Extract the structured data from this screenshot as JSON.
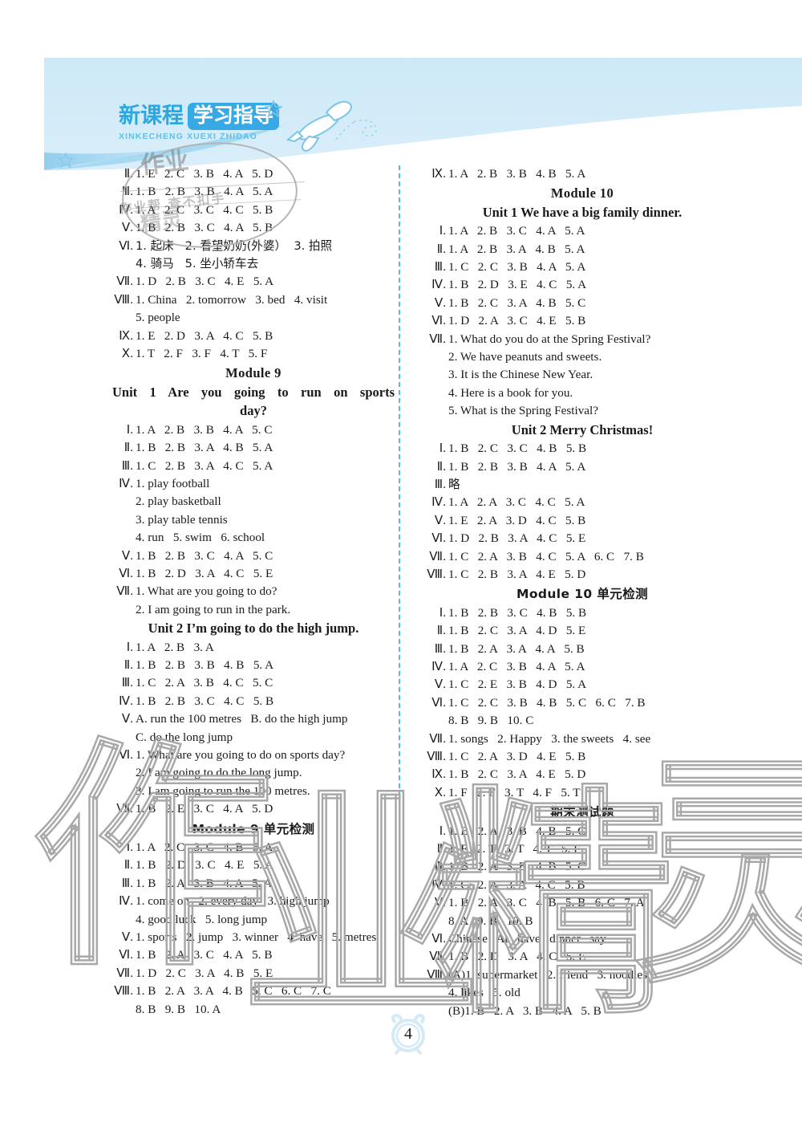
{
  "header": {
    "logo_cn_plain": "新课程",
    "logo_cn_chip": "学习指导",
    "logo_pinyin": "XINKECHENG XUEXI ZHIDAO",
    "plane_icon": "airplane-icon",
    "star_icon": "star-icon"
  },
  "watermark": {
    "chars": [
      "作",
      "业",
      "精",
      "灵"
    ],
    "stamp": "作业",
    "stamp_small": "作业帮 查不扣手",
    "stamp_sub": "精灵"
  },
  "footer": {
    "page_number": "4",
    "clock_icon": "alarm-clock-icon"
  },
  "left_column": {
    "blocks": [
      {
        "type": "answer",
        "rn": "Ⅱ.",
        "text": "1. E   2. C   3. B   4. A   5. D"
      },
      {
        "type": "answer",
        "rn": "Ⅲ.",
        "text": "1. B   2. B   3. B   4. A   5. A"
      },
      {
        "type": "answer",
        "rn": "Ⅳ.",
        "text": "1. A   2. C   3. C   4. C   5. B"
      },
      {
        "type": "answer",
        "rn": "Ⅴ.",
        "text": "1. B   2. B   3. C   4. A   5. B"
      },
      {
        "type": "answer",
        "rn": "Ⅵ.",
        "text": "1. 起床   2. 看望奶奶(外婆）  3. 拍照",
        "cn": true
      },
      {
        "type": "cont",
        "text": "4. 骑马   5. 坐小轿车去",
        "cn": true
      },
      {
        "type": "answer",
        "rn": "Ⅶ.",
        "text": "1. D   2. B   3. C   4. E   5. A"
      },
      {
        "type": "answer",
        "rn": "Ⅷ.",
        "text": "1. China   2. tomorrow   3. bed   4. visit"
      },
      {
        "type": "cont",
        "text": "5. people"
      },
      {
        "type": "answer",
        "rn": "Ⅸ.",
        "text": "1. E   2. D   3. A   4. C   5. B"
      },
      {
        "type": "answer",
        "rn": "Ⅹ.",
        "text": "1. T   2. F   3. F   4. T   5. F"
      },
      {
        "type": "module",
        "text": "Module 9"
      },
      {
        "type": "unit_justify",
        "text": "Unit 1   Are you going to run on sports"
      },
      {
        "type": "unit_center",
        "text": "day?"
      },
      {
        "type": "answer",
        "rn": "Ⅰ.",
        "text": "1. A   2. B   3. B   4. A   5. C"
      },
      {
        "type": "answer",
        "rn": "Ⅱ.",
        "text": "1. B   2. B   3. A   4. B   5. A"
      },
      {
        "type": "answer",
        "rn": "Ⅲ.",
        "text": "1. C   2. B   3. A   4. C   5. A"
      },
      {
        "type": "answer",
        "rn": "Ⅳ.",
        "text": "1. play football"
      },
      {
        "type": "cont",
        "text": "2. play basketball"
      },
      {
        "type": "cont",
        "text": "3. play table tennis"
      },
      {
        "type": "cont",
        "text": "4. run   5. swim   6. school"
      },
      {
        "type": "answer",
        "rn": "Ⅴ.",
        "text": "1. B   2. B   3. C   4. A   5. C"
      },
      {
        "type": "answer",
        "rn": "Ⅵ.",
        "text": "1. B   2. D   3. A   4. C   5. E"
      },
      {
        "type": "answer",
        "rn": "Ⅶ.",
        "text": "1. What are you going to do?"
      },
      {
        "type": "cont",
        "text": "2. I am going to run in the park."
      },
      {
        "type": "unit_center",
        "text": "Unit 2   I’m going to do the high jump."
      },
      {
        "type": "answer",
        "rn": "Ⅰ.",
        "text": "1. A   2. B   3. A"
      },
      {
        "type": "answer",
        "rn": "Ⅱ.",
        "text": "1. B   2. B   3. B   4. B   5. A"
      },
      {
        "type": "answer",
        "rn": "Ⅲ.",
        "text": "1. C   2. A   3. B   4. C   5. C"
      },
      {
        "type": "answer",
        "rn": "Ⅳ.",
        "text": "1. B   2. B   3. C   4. C   5. B"
      },
      {
        "type": "answer",
        "rn": "Ⅴ.",
        "text": "A. run the 100 metres   B. do the high jump"
      },
      {
        "type": "cont",
        "text": "C. do the long jump"
      },
      {
        "type": "answer",
        "rn": "Ⅵ.",
        "text": "1. What are you going to do on sports day?"
      },
      {
        "type": "cont",
        "text": "2. I am going to do the long jump."
      },
      {
        "type": "cont",
        "text": "3. I am going to run the 100 metres."
      },
      {
        "type": "answer",
        "rn": "Ⅶ.",
        "text": "1. B   2. E   3. C   4. A   5. D"
      },
      {
        "type": "module_cn",
        "text": "Module 9   单元检测"
      },
      {
        "type": "answer",
        "rn": "Ⅰ.",
        "text": "1. A   2. C   3. C   4. B   5. A"
      },
      {
        "type": "answer",
        "rn": "Ⅱ.",
        "text": "1. B   2. D   3. C   4. E   5. A"
      },
      {
        "type": "answer",
        "rn": "Ⅲ.",
        "text": "1. B   2. A   3. B   4. A   5. A"
      },
      {
        "type": "answer",
        "rn": "Ⅳ.",
        "text": "1. come on   2. every day   3. high jump"
      },
      {
        "type": "cont",
        "text": "4. good luck   5. long jump"
      },
      {
        "type": "answer",
        "rn": "Ⅴ.",
        "text": "1. sports   2. jump   3. winner   4. have   5. metres"
      },
      {
        "type": "answer",
        "rn": "Ⅵ.",
        "text": "1. B   2. A   3. C   4. A   5. B"
      },
      {
        "type": "answer",
        "rn": "Ⅶ.",
        "text": "1. D   2. C   3. A   4. B   5. E"
      },
      {
        "type": "answer",
        "rn": "Ⅷ.",
        "text": "1. B   2. A   3. A   4. B   5. C   6. C   7. C"
      },
      {
        "type": "cont",
        "text": "8. B   9. B   10. A"
      }
    ]
  },
  "right_column": {
    "blocks": [
      {
        "type": "answer",
        "rn": "Ⅸ.",
        "text": "1. A   2. B   3. B   4. B   5. A"
      },
      {
        "type": "module",
        "text": "Module 10"
      },
      {
        "type": "unit_center",
        "text": "Unit 1   We have a big family dinner."
      },
      {
        "type": "answer",
        "rn": "Ⅰ.",
        "text": "1. A   2. B   3. C   4. A   5. A"
      },
      {
        "type": "answer",
        "rn": "Ⅱ.",
        "text": "1. A   2. B   3. A   4. B   5. A"
      },
      {
        "type": "answer",
        "rn": "Ⅲ.",
        "text": "1. C   2. C   3. B   4. A   5. A"
      },
      {
        "type": "answer",
        "rn": "Ⅳ.",
        "text": "1. B   2. D   3. E   4. C   5. A"
      },
      {
        "type": "answer",
        "rn": "Ⅴ.",
        "text": "1. B   2. C   3. A   4. B   5. C"
      },
      {
        "type": "answer",
        "rn": "Ⅵ.",
        "text": "1. D   2. A   3. C   4. E   5. B"
      },
      {
        "type": "answer",
        "rn": "Ⅶ.",
        "text": "1. What do you do at the Spring Festival?"
      },
      {
        "type": "cont",
        "text": "2. We have peanuts and sweets."
      },
      {
        "type": "cont",
        "text": "3. It is the Chinese New Year."
      },
      {
        "type": "cont",
        "text": "4. Here is a book for you."
      },
      {
        "type": "cont",
        "text": "5. What is the Spring Festival?"
      },
      {
        "type": "unit_center",
        "text": "Unit 2   Merry Christmas!"
      },
      {
        "type": "answer",
        "rn": "Ⅰ.",
        "text": "1. B   2. C   3. C   4. B   5. B"
      },
      {
        "type": "answer",
        "rn": "Ⅱ.",
        "text": "1. B   2. B   3. B   4. A   5. A"
      },
      {
        "type": "answer",
        "rn": "Ⅲ.",
        "text": "略",
        "cn": true
      },
      {
        "type": "answer",
        "rn": "Ⅳ.",
        "text": "1. A   2. A   3. C   4. C   5. A"
      },
      {
        "type": "answer",
        "rn": "Ⅴ.",
        "text": "1. E   2. A   3. D   4. C   5. B"
      },
      {
        "type": "answer",
        "rn": "Ⅵ.",
        "text": "1. D   2. B   3. A   4. C   5. E"
      },
      {
        "type": "answer",
        "rn": "Ⅶ.",
        "text": "1. C   2. A   3. B   4. C   5. A   6. C   7. B"
      },
      {
        "type": "answer",
        "rn": "Ⅷ.",
        "text": "1. C   2. B   3. A   4. E   5. D"
      },
      {
        "type": "module_cn",
        "text": "Module 10   单元检测"
      },
      {
        "type": "answer",
        "rn": "Ⅰ.",
        "text": "1. B   2. B   3. C   4. B   5. B"
      },
      {
        "type": "answer",
        "rn": "Ⅱ.",
        "text": "1. B   2. C   3. A   4. D   5. E"
      },
      {
        "type": "answer",
        "rn": "Ⅲ.",
        "text": "1. B   2. A   3. A   4. A   5. B"
      },
      {
        "type": "answer",
        "rn": "Ⅳ.",
        "text": "1. A   2. C   3. B   4. A   5. A"
      },
      {
        "type": "answer",
        "rn": "Ⅴ.",
        "text": "1. C   2. E   3. B   4. D   5. A"
      },
      {
        "type": "answer",
        "rn": "Ⅵ.",
        "text": "1. C   2. C   3. B   4. B   5. C   6. C   7. B"
      },
      {
        "type": "cont",
        "text": "8. B   9. B   10. C"
      },
      {
        "type": "answer",
        "rn": "Ⅶ.",
        "text": "1. songs   2. Happy   3. the sweets   4. see"
      },
      {
        "type": "answer",
        "rn": "Ⅷ.",
        "text": "1. C   2. A   3. D   4. E   5. B"
      },
      {
        "type": "answer",
        "rn": "Ⅸ.",
        "text": "1. B   2. C   3. A   4. E   5. D"
      },
      {
        "type": "answer",
        "rn": "Ⅹ.",
        "text": "1. F   2. F   3. T   4. F   5. T"
      },
      {
        "type": "module_cn",
        "text": "期末测试题"
      },
      {
        "type": "answer",
        "rn": "Ⅰ.",
        "text": "1. B   2. A   3. B   4. B   5. C"
      },
      {
        "type": "answer",
        "rn": "Ⅱ.",
        "text": "1. F   2. T   3. T   4. T   5. F"
      },
      {
        "type": "answer",
        "rn": "Ⅲ.",
        "text": "1. B   2. A   3. B   4. B   5. C"
      },
      {
        "type": "answer",
        "rn": "Ⅳ.",
        "text": "1. C   2. A   3. A   4. C   5. B"
      },
      {
        "type": "answer",
        "rn": "Ⅴ.",
        "text": "1. B   2. A   3. C   4. B   5. B   6. C   7. A"
      },
      {
        "type": "cont",
        "text": "8. A   9. B   10. B"
      },
      {
        "type": "answer",
        "rn": "Ⅵ.",
        "text": "Chinese   At   have   dinner   say"
      },
      {
        "type": "answer",
        "rn": "Ⅶ.",
        "text": "1. B   2. D   3. A   4. C   5. E"
      },
      {
        "type": "answer",
        "rn": "Ⅷ.",
        "text": "(A)1. supermarket   2. friend   3. noodles"
      },
      {
        "type": "cont",
        "text": "4. likes   5. old"
      },
      {
        "type": "cont",
        "text": "(B)1. B   2. A   3. B   4. A   5. B"
      }
    ]
  }
}
